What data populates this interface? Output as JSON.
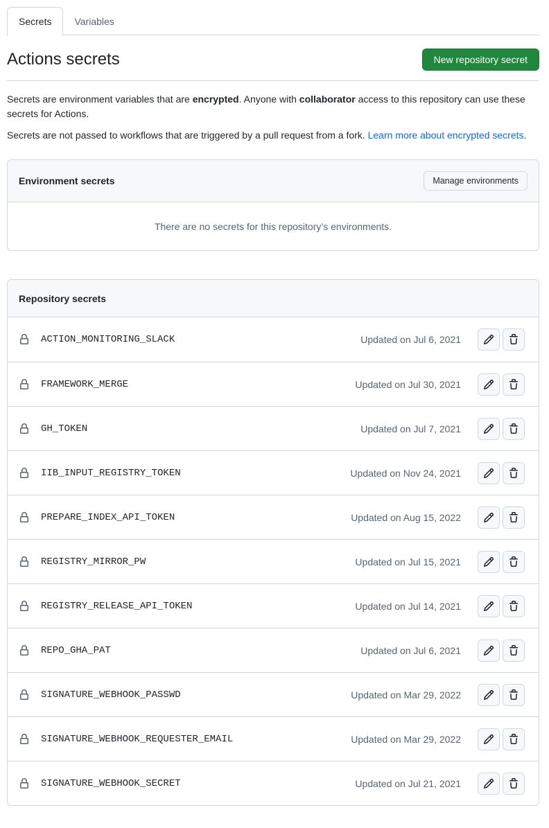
{
  "tabs": [
    {
      "label": "Secrets",
      "active": true
    },
    {
      "label": "Variables",
      "active": false
    }
  ],
  "header": {
    "title": "Actions secrets",
    "new_button": "New repository secret"
  },
  "intro": {
    "p1_a": "Secrets are environment variables that are ",
    "p1_b": "encrypted",
    "p1_c": ". Anyone with ",
    "p1_d": "collaborator",
    "p1_e": " access to this repository can use these secrets for Actions.",
    "p2_a": "Secrets are not passed to workflows that are triggered by a pull request from a fork. ",
    "p2_link": "Learn more about encrypted secrets",
    "p2_end": "."
  },
  "environment": {
    "title": "Environment secrets",
    "manage_button": "Manage environments",
    "empty_text": "There are no secrets for this repository’s environments."
  },
  "repository": {
    "title": "Repository secrets",
    "secrets": [
      {
        "name": "ACTION_MONITORING_SLACK",
        "updated": "Updated on Jul 6, 2021"
      },
      {
        "name": "FRAMEWORK_MERGE",
        "updated": "Updated on Jul 30, 2021"
      },
      {
        "name": "GH_TOKEN",
        "updated": "Updated on Jul 7, 2021"
      },
      {
        "name": "IIB_INPUT_REGISTRY_TOKEN",
        "updated": "Updated on Nov 24, 2021"
      },
      {
        "name": "PREPARE_INDEX_API_TOKEN",
        "updated": "Updated on Aug 15, 2022"
      },
      {
        "name": "REGISTRY_MIRROR_PW",
        "updated": "Updated on Jul 15, 2021"
      },
      {
        "name": "REGISTRY_RELEASE_API_TOKEN",
        "updated": "Updated on Jul 14, 2021"
      },
      {
        "name": "REPO_GHA_PAT",
        "updated": "Updated on Jul 6, 2021"
      },
      {
        "name": "SIGNATURE_WEBHOOK_PASSWD",
        "updated": "Updated on Mar 29, 2022"
      },
      {
        "name": "SIGNATURE_WEBHOOK_REQUESTER_EMAIL",
        "updated": "Updated on Mar 29, 2022"
      },
      {
        "name": "SIGNATURE_WEBHOOK_SECRET",
        "updated": "Updated on Jul 21, 2021"
      }
    ]
  },
  "icons": {
    "row_icon": "lock-icon",
    "edit": "pencil-icon",
    "delete": "trash-icon"
  },
  "colors": {
    "primary_button": "#1f883d",
    "link": "#0969da",
    "muted_text": "#59636e",
    "border": "#d1d9e0"
  }
}
